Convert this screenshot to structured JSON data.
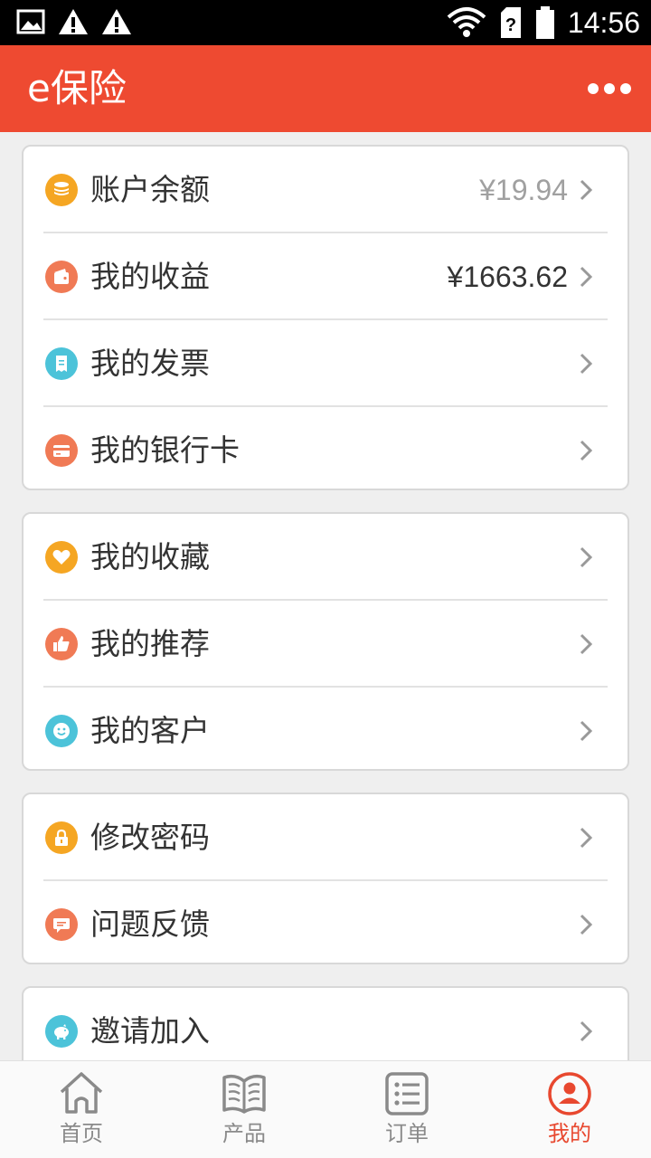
{
  "status_bar": {
    "time": "14:56",
    "icons": [
      "image-icon",
      "warning-icon",
      "warning-icon",
      "wifi-icon",
      "sim-unknown-icon",
      "battery-icon"
    ]
  },
  "app_bar": {
    "title": "e保险",
    "more_icon": "more-horizontal-icon"
  },
  "colors": {
    "brand": "#ee4a31",
    "orange": "#f5a623",
    "coral": "#f07a55",
    "teal": "#4cc3d9",
    "value_gray": "#a0a0a0",
    "value_dark": "#333333"
  },
  "groups": [
    {
      "items": [
        {
          "label": "账户余额",
          "value": "¥19.94",
          "icon": "coins-icon",
          "color": "#f5a623"
        },
        {
          "label": "我的收益",
          "value": "¥1663.62",
          "icon": "wallet-icon",
          "color": "#f07a55"
        },
        {
          "label": "我的发票",
          "value": "",
          "icon": "receipt-icon",
          "color": "#4cc3d9"
        },
        {
          "label": "我的银行卡",
          "value": "",
          "icon": "bank-card-icon",
          "color": "#f07a55"
        }
      ]
    },
    {
      "items": [
        {
          "label": "我的收藏",
          "icon": "heart-icon",
          "color": "#f5a623"
        },
        {
          "label": "我的推荐",
          "icon": "thumbs-up-icon",
          "color": "#f07a55"
        },
        {
          "label": "我的客户",
          "icon": "smiley-icon",
          "color": "#4cc3d9"
        }
      ]
    },
    {
      "items": [
        {
          "label": "修改密码",
          "icon": "lock-icon",
          "color": "#f5a623"
        },
        {
          "label": "问题反馈",
          "icon": "chat-bubble-icon",
          "color": "#f07a55"
        }
      ]
    },
    {
      "items": [
        {
          "label": "邀请加入",
          "icon": "piggy-bank-icon",
          "color": "#4cc3d9"
        }
      ]
    }
  ],
  "tabs": [
    {
      "label": "首页",
      "icon": "home-icon",
      "active": false
    },
    {
      "label": "产品",
      "icon": "book-icon",
      "active": false
    },
    {
      "label": "订单",
      "icon": "list-icon",
      "active": false
    },
    {
      "label": "我的",
      "icon": "user-circle-icon",
      "active": true
    }
  ]
}
